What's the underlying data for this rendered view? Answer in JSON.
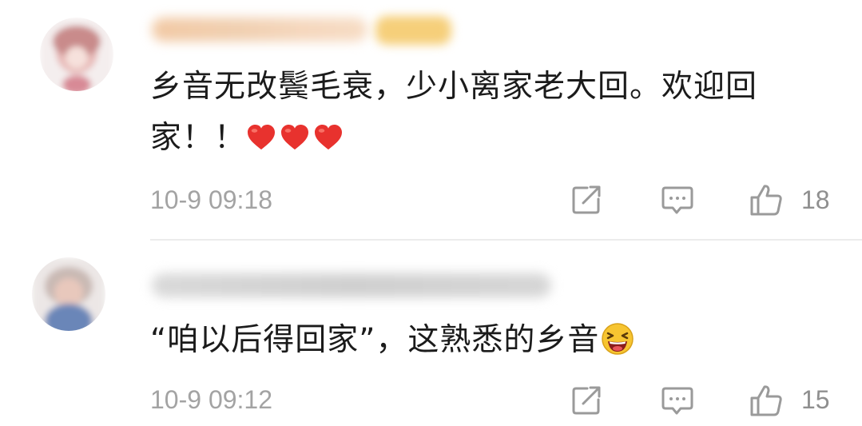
{
  "comments": [
    {
      "text": "乡音无改鬓毛衰，少小离家老大回。欢迎回家！！",
      "emoji": [
        "red-heart",
        "red-heart",
        "red-heart"
      ],
      "time": "10-9 09:18",
      "likes": "18"
    },
    {
      "text": "“咱以后得回家”，这熟悉的乡音",
      "emoji": [
        "grinning-squinting-face"
      ],
      "time": "10-9 09:12",
      "likes": "15"
    }
  ],
  "colors": {
    "text": "#1b1b1b",
    "meta": "#a3a3a3",
    "icon": "#9a9a9a",
    "heart": "#e8322e",
    "emoji_face": "#f7c531"
  },
  "icons": {
    "share": "share-edit-icon",
    "reply": "comment-bubble-icon",
    "like": "thumbs-up-icon"
  }
}
